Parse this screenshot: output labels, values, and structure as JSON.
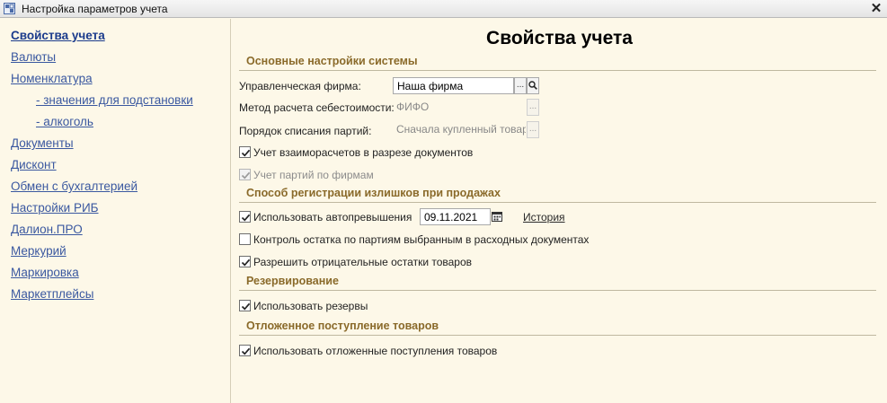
{
  "window": {
    "title": "Настройка параметров учета",
    "close_glyph": "✕"
  },
  "nav": {
    "items": [
      {
        "label": "Свойства учета",
        "active": true,
        "sub": false
      },
      {
        "label": "Валюты",
        "sub": false
      },
      {
        "label": "Номенклатура",
        "sub": false
      },
      {
        "label": "- значения для подстановки",
        "sub": true
      },
      {
        "label": "- алкоголь",
        "sub": true
      },
      {
        "label": "Документы",
        "sub": false
      },
      {
        "label": "Дисконт",
        "sub": false
      },
      {
        "label": "Обмен с бухгалтерией",
        "sub": false
      },
      {
        "label": "Настройки РИБ",
        "sub": false
      },
      {
        "label": "Далион.ПРО",
        "sub": false
      },
      {
        "label": "Меркурий",
        "sub": false
      },
      {
        "label": "Маркировка",
        "sub": false
      },
      {
        "label": "Маркетплейсы",
        "sub": false
      }
    ]
  },
  "main": {
    "title": "Свойства учета",
    "sections": {
      "basic": "Основные настройки системы",
      "surplus": "Способ регистрации излишков при продажах",
      "reserve": "Резервирование",
      "deferred": "Отложенное поступление товаров"
    },
    "fields": {
      "firm": {
        "label": "Управленческая фирма:",
        "value": "Наша фирма",
        "select_glyph": "...",
        "search_icon": "magnifier-icon"
      },
      "cost_method": {
        "label": "Метод расчета себестоимости:",
        "value": "ФИФО",
        "select_glyph": "..."
      },
      "writeoff": {
        "label": "Порядок списания партий:",
        "value": "Сначала купленный товар",
        "select_glyph": "..."
      }
    },
    "checkboxes": {
      "settlements_by_docs": {
        "label": "Учет взаиморасчетов в разрезе документов",
        "checked": true,
        "disabled": false
      },
      "batches_by_firms": {
        "label": "Учет партий по фирмам",
        "checked": true,
        "disabled": true
      },
      "auto_surplus": {
        "label": "Использовать автопревышения",
        "checked": true,
        "disabled": false
      },
      "batch_control": {
        "label": "Контроль остатка по партиям выбранным в расходных документах",
        "checked": false,
        "disabled": false
      },
      "negative_stock": {
        "label": "Разрешить отрицательные остатки товаров",
        "checked": true,
        "disabled": false
      },
      "use_reserves": {
        "label": "Использовать резервы",
        "checked": true,
        "disabled": false
      },
      "use_deferred": {
        "label": "Использовать отложенные поступления товаров",
        "checked": true,
        "disabled": false
      }
    },
    "auto_surplus_date": "09.11.2021",
    "history_link": "История"
  },
  "colors": {
    "background": "#fdf8e8",
    "section": "#8a6a2a",
    "link": "#3a58a0"
  }
}
